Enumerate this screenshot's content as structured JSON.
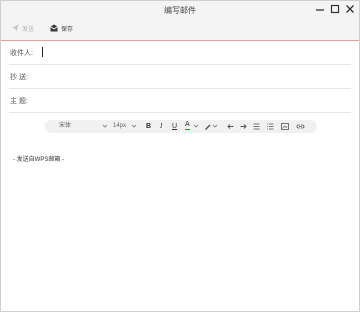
{
  "window": {
    "title": "编写邮件"
  },
  "toolbar": {
    "send_label": "发送",
    "save_label": "保存"
  },
  "fields": {
    "to_label": "收件人:",
    "cc_label": "抄 送:",
    "subject_label": "主 题:",
    "to_value": "",
    "cc_value": "",
    "subject_value": ""
  },
  "editor": {
    "font_family": "宋体",
    "font_size": "14px",
    "bold": "B",
    "italic": "I",
    "underline": "U",
    "font_color": "A",
    "signature": "- 发送自WPS邮箱 -"
  },
  "colors": {
    "accent_line": "#e2a3a3",
    "font_color_bar": "#e53935"
  }
}
